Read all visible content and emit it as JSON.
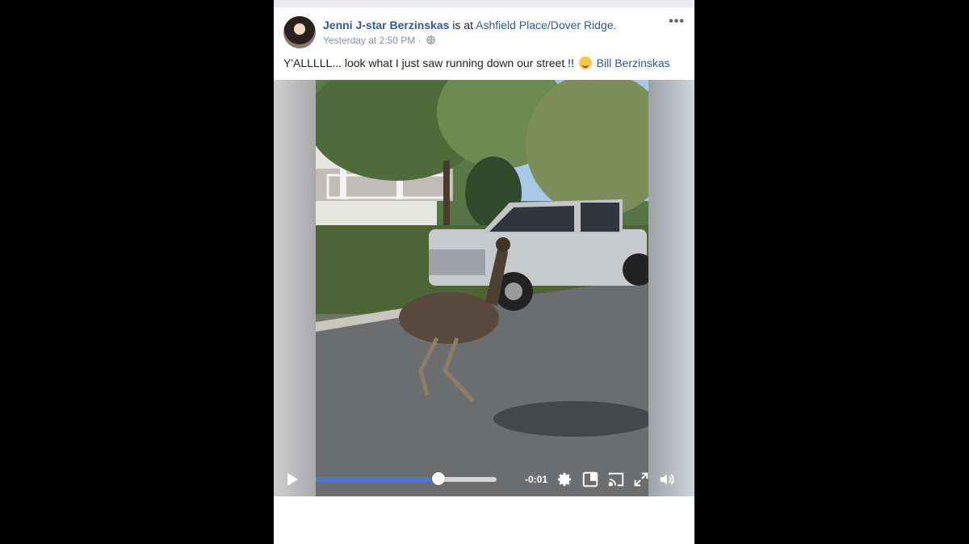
{
  "post": {
    "author": "Jenni J-star Berzinskas",
    "location_prefix": "is at",
    "location": "Ashfield Place/Dover Ridge.",
    "timestamp": "Yesterday at 2:50 PM",
    "separator": "·",
    "more_label": "•••",
    "text": "Y'ALLLLL... look what I just saw running down our street !!",
    "tagged_user": "Bill Berzinskas"
  },
  "video": {
    "progress_percent": 68,
    "time_remaining": "-0:01",
    "icons": [
      "play-icon",
      "settings-gear-icon",
      "picture-in-picture-icon",
      "cast-icon",
      "fullscreen-icon",
      "volume-icon"
    ]
  },
  "colors": {
    "link": "#365899",
    "progress": "#4a76d1",
    "background": "#000000"
  }
}
